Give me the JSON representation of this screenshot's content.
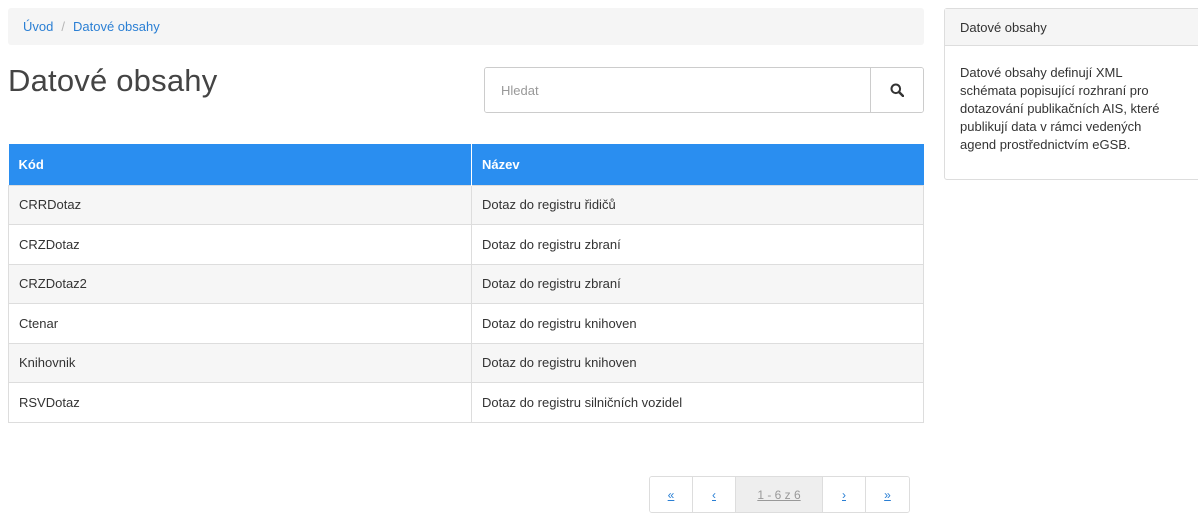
{
  "breadcrumb": {
    "home": "Úvod",
    "separator": "/",
    "current": "Datové obsahy"
  },
  "page": {
    "title": "Datové obsahy"
  },
  "search": {
    "placeholder": "Hledat",
    "button_icon": "search-icon"
  },
  "table": {
    "columns": [
      "Kód",
      "Název"
    ],
    "rows": [
      {
        "code": "CRRDotaz",
        "name": "Dotaz do registru řidičů"
      },
      {
        "code": "CRZDotaz",
        "name": "Dotaz do registru zbraní"
      },
      {
        "code": "CRZDotaz2",
        "name": "Dotaz do registru zbraní"
      },
      {
        "code": "Ctenar",
        "name": "Dotaz do registru knihoven"
      },
      {
        "code": "Knihovnik",
        "name": "Dotaz do registru knihoven"
      },
      {
        "code": "RSVDotaz",
        "name": "Dotaz do registru silničních vozidel"
      }
    ]
  },
  "pagination": {
    "first": "«",
    "prev": "‹",
    "info": "1 - 6 z 6",
    "next": "›",
    "last": "»"
  },
  "sidebar": {
    "title": "Datové obsahy",
    "text": "Datové obsahy definují XML schémata popisující rozhraní pro dotazování publikačních AIS, které publikují data v rámci vedených agend prostřednictvím eGSB."
  },
  "colors": {
    "accent": "#2a8ef0",
    "link": "#2a7fd4"
  }
}
